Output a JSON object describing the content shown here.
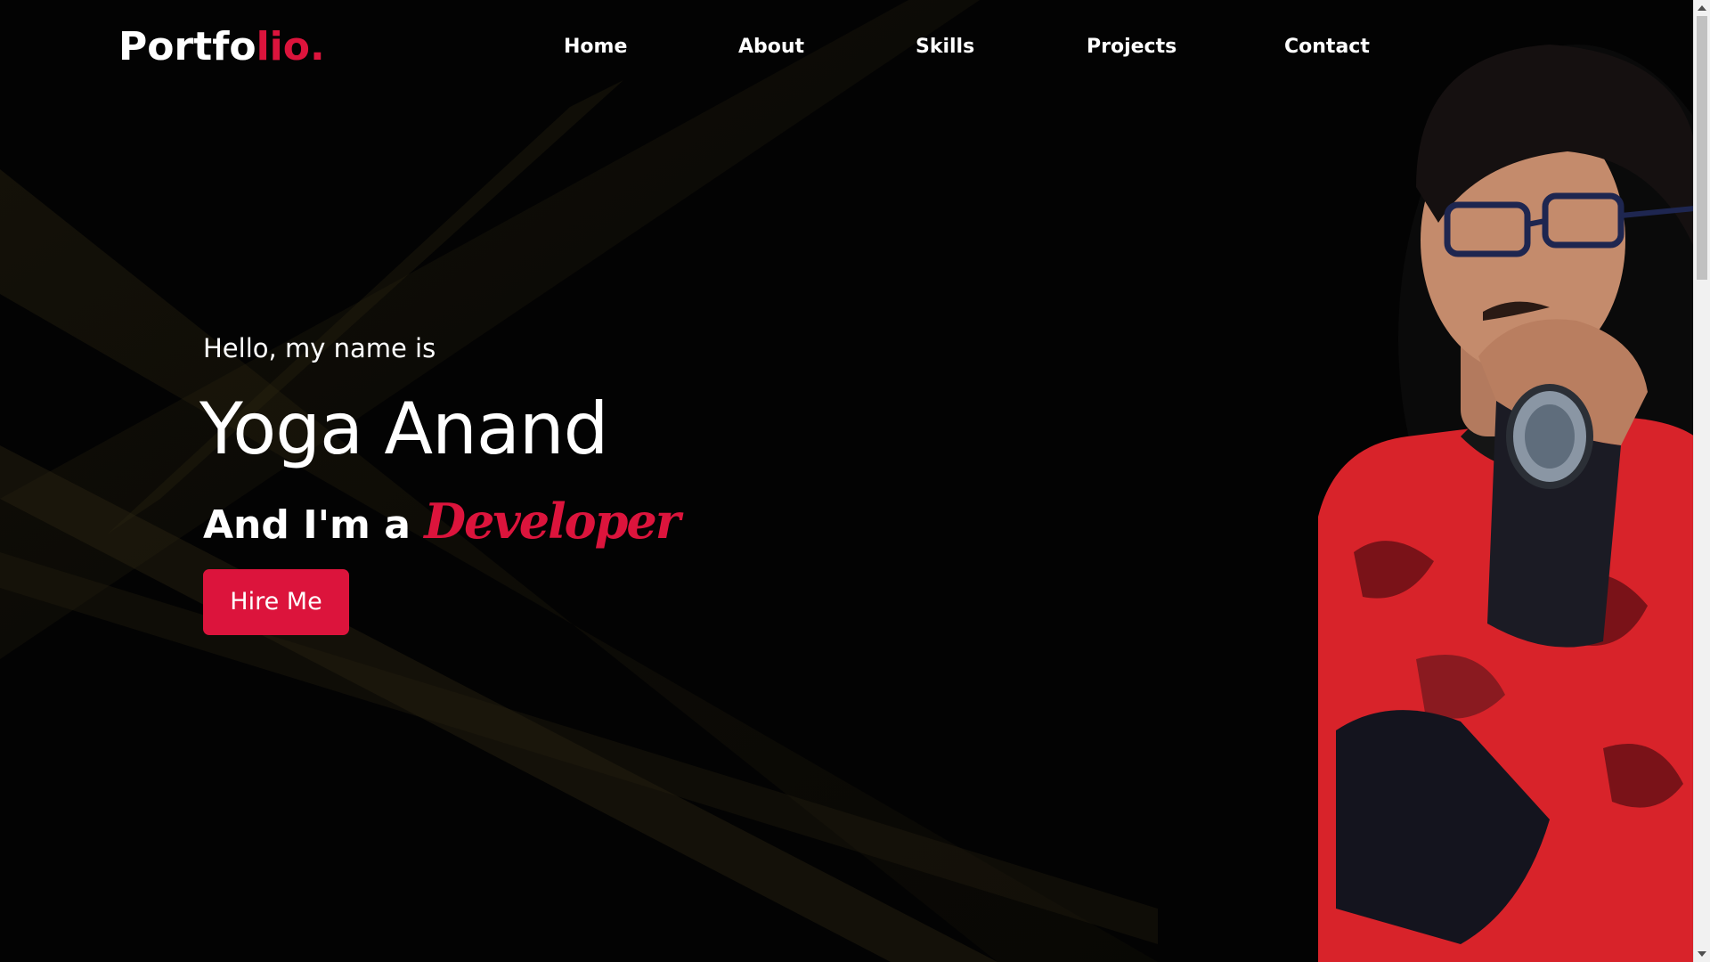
{
  "logo": {
    "main": "Portfo",
    "accent": "lio."
  },
  "nav": {
    "items": [
      {
        "label": "Home"
      },
      {
        "label": "About"
      },
      {
        "label": "Skills"
      },
      {
        "label": "Projects"
      },
      {
        "label": "Contact"
      }
    ]
  },
  "hero": {
    "greeting": "Hello, my name is",
    "name": "Yoga Anand",
    "role_prefix": "And I'm a ",
    "role": "Developer",
    "cta_label": "Hire Me"
  },
  "colors": {
    "accent": "#dc143c",
    "background": "#030303",
    "text": "#ffffff",
    "beam": "#2a2412"
  },
  "icons": {
    "scroll_up": "scroll-up-arrow-icon",
    "scroll_down": "scroll-down-arrow-icon"
  }
}
